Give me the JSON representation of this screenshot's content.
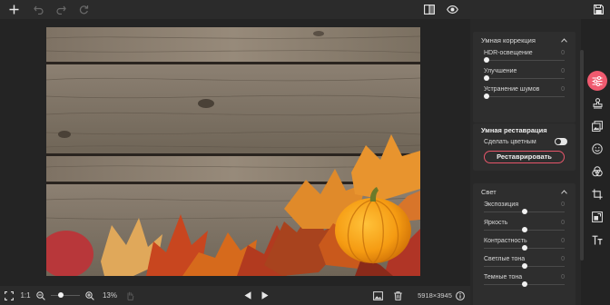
{
  "toolbar": {
    "left_icons": [
      "plus-icon",
      "undo-icon",
      "redo-icon",
      "reset-icon"
    ],
    "right_icons": [
      "compare-icon",
      "eye-icon"
    ],
    "save_icon": "save-icon"
  },
  "bottombar": {
    "fit_icon": "fit-screen-icon",
    "ratio_label": "1:1",
    "zoom_out_icon": "zoom-out-icon",
    "zoom_in_icon": "zoom-in-icon",
    "zoom_level": "13%",
    "zoom_fraction": 0.35,
    "hand_icon": "hand-icon",
    "prev_icon": "prev-arrow-icon",
    "next_icon": "next-arrow-icon",
    "image_icon": "image-icon",
    "delete_icon": "trash-icon",
    "dimensions": "5918×3945",
    "info_icon": "info-icon"
  },
  "panel": {
    "smart_correction": {
      "title": "Умная коррекция",
      "rows": [
        {
          "label": "HDR-освещение",
          "value": "0",
          "level": 0
        },
        {
          "label": "Улучшение",
          "value": "0",
          "level": 0
        },
        {
          "label": "Устранение шумов",
          "value": "0",
          "level": 0
        }
      ]
    },
    "smart_restoration": {
      "title": "Умная реставрация",
      "colorize_label": "Сделать цветным",
      "button_label": "Реставрировать"
    },
    "light": {
      "title": "Свет",
      "rows": [
        {
          "label": "Экспозиция",
          "value": "0",
          "level": 0.5
        },
        {
          "label": "Яркость",
          "value": "0",
          "level": 0.5
        },
        {
          "label": "Контрастность",
          "value": "0",
          "level": 0.5
        },
        {
          "label": "Светлые тона",
          "value": "0",
          "level": 0.5
        },
        {
          "label": "Темные тона",
          "value": "0",
          "level": 0.5
        }
      ]
    }
  },
  "strip": {
    "tools": [
      "adjustments-icon",
      "stamp-icon",
      "layers-icon",
      "face-icon",
      "color-circles-icon",
      "crop-icon",
      "resize-icon",
      "text-icon"
    ],
    "active_index": 0
  },
  "colors": {
    "accent": "#ef5a6f",
    "background": "#232323",
    "panel": "#2e2e2e"
  }
}
